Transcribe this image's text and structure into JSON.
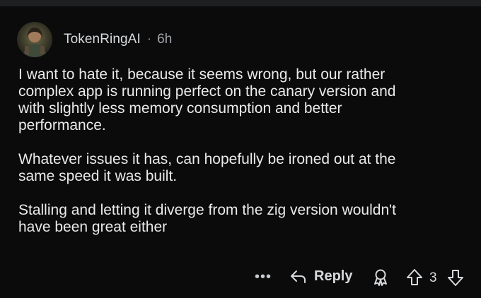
{
  "comment": {
    "author": "TokenRingAI",
    "separator": "·",
    "time": "6h",
    "paragraphs": [
      "I want to hate it, because it seems wrong, but our rather\ncomplex app is running perfect on the canary version and\nwith slightly less memory consumption and better\nperformance.",
      "Whatever issues it has, can hopefully be ironed out at the\nsame speed it was built.",
      "Stalling and letting it diverge from the zig version wouldn't\nhave been great either"
    ]
  },
  "actions": {
    "more_label": "•••",
    "reply_label": "Reply",
    "vote_count": "3"
  },
  "colors": {
    "background": "#0b0b0c",
    "text": "#eaeaeb",
    "muted": "#a3a7ab"
  },
  "icons": {
    "avatar": "avatar-image",
    "reply": "reply-arrow-icon",
    "award": "award-icon",
    "upvote": "upvote-arrow-icon",
    "downvote": "downvote-arrow-icon"
  }
}
